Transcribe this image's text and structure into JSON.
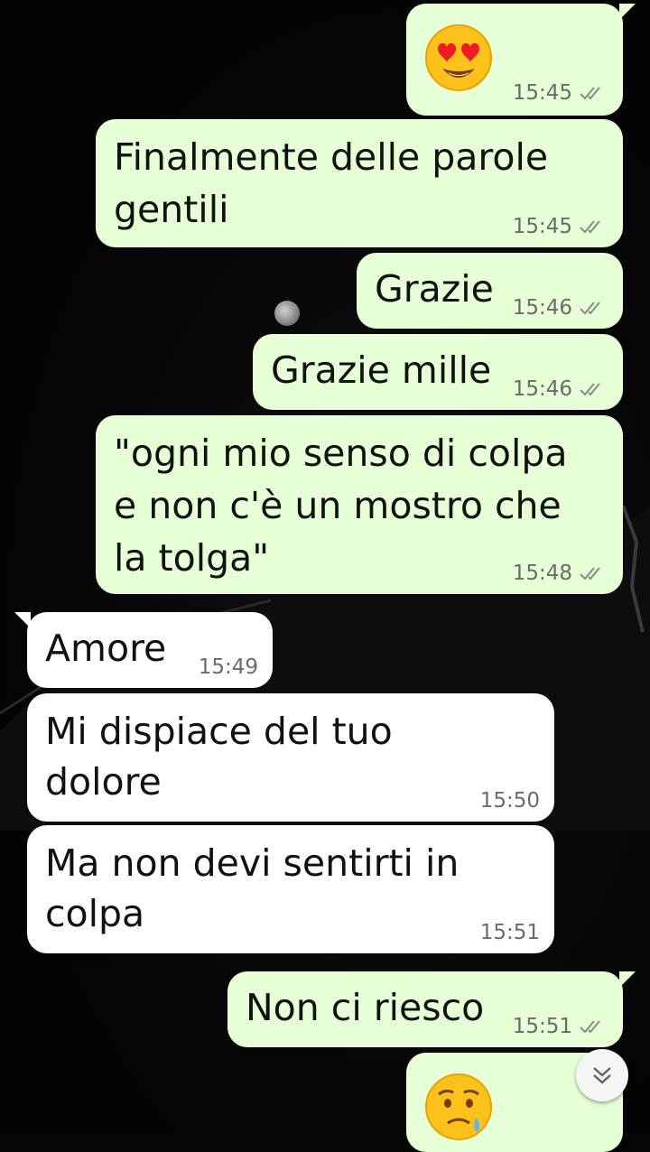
{
  "chat": {
    "messages": [
      {
        "id": "m1",
        "direction": "outgoing",
        "emoji": "heart-eyes-face",
        "time": "15:45",
        "status": "read"
      },
      {
        "id": "m2",
        "direction": "outgoing",
        "lines": [
          "Finalmente delle parole",
          "gentili"
        ],
        "time": "15:45",
        "status": "read"
      },
      {
        "id": "m3",
        "direction": "outgoing",
        "lines": [
          "Grazie"
        ],
        "time": "15:46",
        "status": "read"
      },
      {
        "id": "m4",
        "direction": "outgoing",
        "lines": [
          "Grazie mille"
        ],
        "time": "15:46",
        "status": "read"
      },
      {
        "id": "m5",
        "direction": "outgoing",
        "lines": [
          "\"ogni mio senso di colpa",
          "e non c'è un mostro che",
          "la tolga\""
        ],
        "time": "15:48",
        "status": "read"
      },
      {
        "id": "m6",
        "direction": "incoming",
        "lines": [
          "Amore"
        ],
        "time": "15:49"
      },
      {
        "id": "m7",
        "direction": "incoming",
        "lines": [
          "Mi dispiace del tuo",
          "dolore"
        ],
        "time": "15:50"
      },
      {
        "id": "m8",
        "direction": "incoming",
        "lines": [
          "Ma non devi sentirti in",
          "colpa"
        ],
        "time": "15:51"
      },
      {
        "id": "m9",
        "direction": "outgoing",
        "lines": [
          "Non ci riesco"
        ],
        "time": "15:51",
        "status": "read"
      },
      {
        "id": "m10",
        "direction": "outgoing",
        "emoji": "sad-but-relieved-face"
      }
    ]
  },
  "colors": {
    "outgoing_bubble": "#e6ffd6",
    "incoming_bubble": "#ffffff",
    "timestamp": "#6b6b6b",
    "wallpaper": "#050505"
  },
  "icons": {
    "read_receipt": "double-check-icon",
    "scroll_down": "double-chevron-down-icon"
  }
}
